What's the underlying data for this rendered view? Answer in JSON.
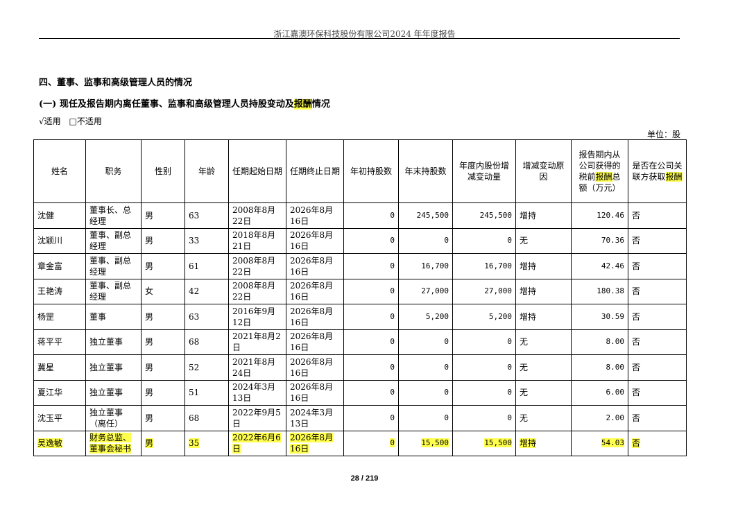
{
  "header": {
    "title": "浙江嘉澳环保科技股份有限公司2024 年年度报告"
  },
  "section_title": "四、董事、监事和高级管理人员的情况",
  "subsection": {
    "prefix": "(一) 现任及报告期内离任董事、监事和高级管理人员持股变动及",
    "highlight": "报酬",
    "suffix": "情况"
  },
  "applicability": {
    "applicable": "√适用",
    "not_applicable": "□不适用"
  },
  "unit": "单位：股",
  "table": {
    "headers": [
      "姓名",
      "职务",
      "性别",
      "年龄",
      "任期起始日期",
      "任期终止日期",
      "年初持股数",
      "年末持股数",
      "年度内股份增减变动量",
      "增减变动原因"
    ],
    "header_pay_pre": "报告期内从公司获得的税前",
    "header_pay_hl": "报酬",
    "header_pay_post": "总额（万元）",
    "header_related_pre": "是否在公司关联方获取",
    "header_related_hl": "报酬",
    "rows": [
      [
        "沈健",
        "董事长、总经理",
        "男",
        "63",
        "2008年8月22日",
        "2026年8月16日",
        "0",
        "245,500",
        "245,500",
        "增持",
        "120.46",
        "否"
      ],
      [
        "沈颖川",
        "董事、副总经理",
        "男",
        "33",
        "2018年8月21日",
        "2026年8月16日",
        "0",
        "0",
        "0",
        "无",
        "70.36",
        "否"
      ],
      [
        "章金富",
        "董事、副总经理",
        "男",
        "61",
        "2008年8月22日",
        "2026年8月16日",
        "0",
        "16,700",
        "16,700",
        "增持",
        "42.46",
        "否"
      ],
      [
        "王艳涛",
        "董事、副总经理",
        "女",
        "42",
        "2008年8月22日",
        "2026年8月16日",
        "0",
        "27,000",
        "27,000",
        "增持",
        "180.38",
        "否"
      ],
      [
        "杨罡",
        "董事",
        "男",
        "63",
        "2016年9月12日",
        "2026年8月16日",
        "0",
        "5,200",
        "5,200",
        "增持",
        "30.59",
        "否"
      ],
      [
        "蒋平平",
        "独立董事",
        "男",
        "68",
        "2021年8月2日",
        "2026年8月16日",
        "0",
        "0",
        "0",
        "无",
        "8.00",
        "否"
      ],
      [
        "冀星",
        "独立董事",
        "男",
        "52",
        "2021年8月24日",
        "2026年8月16日",
        "0",
        "0",
        "0",
        "无",
        "8.00",
        "否"
      ],
      [
        "夏江华",
        "独立董事",
        "男",
        "51",
        "2024年3月13日",
        "2026年8月16日",
        "0",
        "0",
        "0",
        "无",
        "6.00",
        "否"
      ],
      [
        "沈玉平",
        "独立董事（离任）",
        "男",
        "68",
        "2022年9月5日",
        "2024年3月13日",
        "0",
        "0",
        "0",
        "无",
        "2.00",
        "否"
      ],
      [
        "吴逸敏",
        "财务总监、董事会秘书",
        "男",
        "35",
        "2022年6月6日",
        "2026年8月16日",
        "0",
        "15,500",
        "15,500",
        "增持",
        "54.03",
        "否"
      ]
    ]
  },
  "footer": {
    "page": "28 / 219"
  },
  "colors": {
    "highlight": "#ffff4d"
  }
}
